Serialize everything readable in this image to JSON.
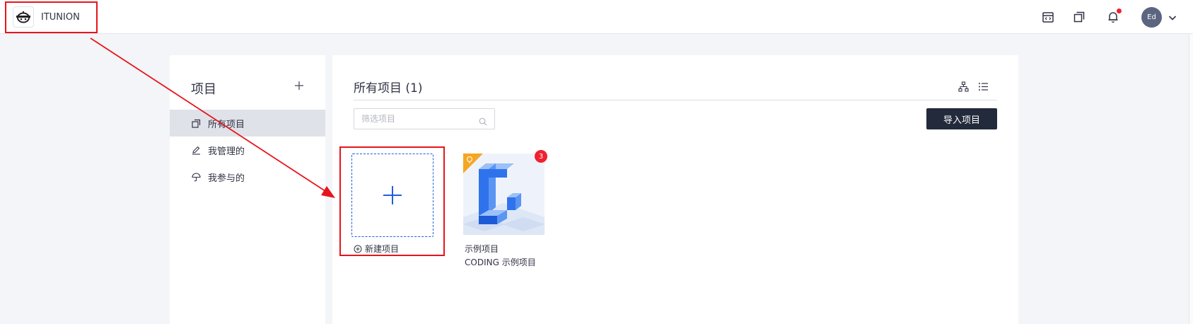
{
  "header": {
    "team_name": "ITUNION",
    "icons": [
      "calendar-code-icon",
      "copy-windows-icon",
      "bell-icon"
    ],
    "avatar_initials": "Ed",
    "notification_dot_color": "#f0212f"
  },
  "sidebar": {
    "title": "项目",
    "items": [
      {
        "label": "所有项目",
        "icon": "copy-icon",
        "active": true
      },
      {
        "label": "我管理的",
        "icon": "pencil-icon",
        "active": false
      },
      {
        "label": "我参与的",
        "icon": "umbrella-icon",
        "active": false
      }
    ]
  },
  "main": {
    "title": "所有项目 (1)",
    "filter_placeholder": "筛选项目",
    "import_label": "导入项目",
    "new_project_label": "新建项目",
    "projects": [
      {
        "name": "示例项目",
        "description": "CODING 示例项目",
        "badge": "3"
      }
    ]
  },
  "colors": {
    "accent": "#1f5fe0",
    "button_dark": "#232a3b",
    "annotation": "#e8141c",
    "badge": "#f0212f"
  }
}
